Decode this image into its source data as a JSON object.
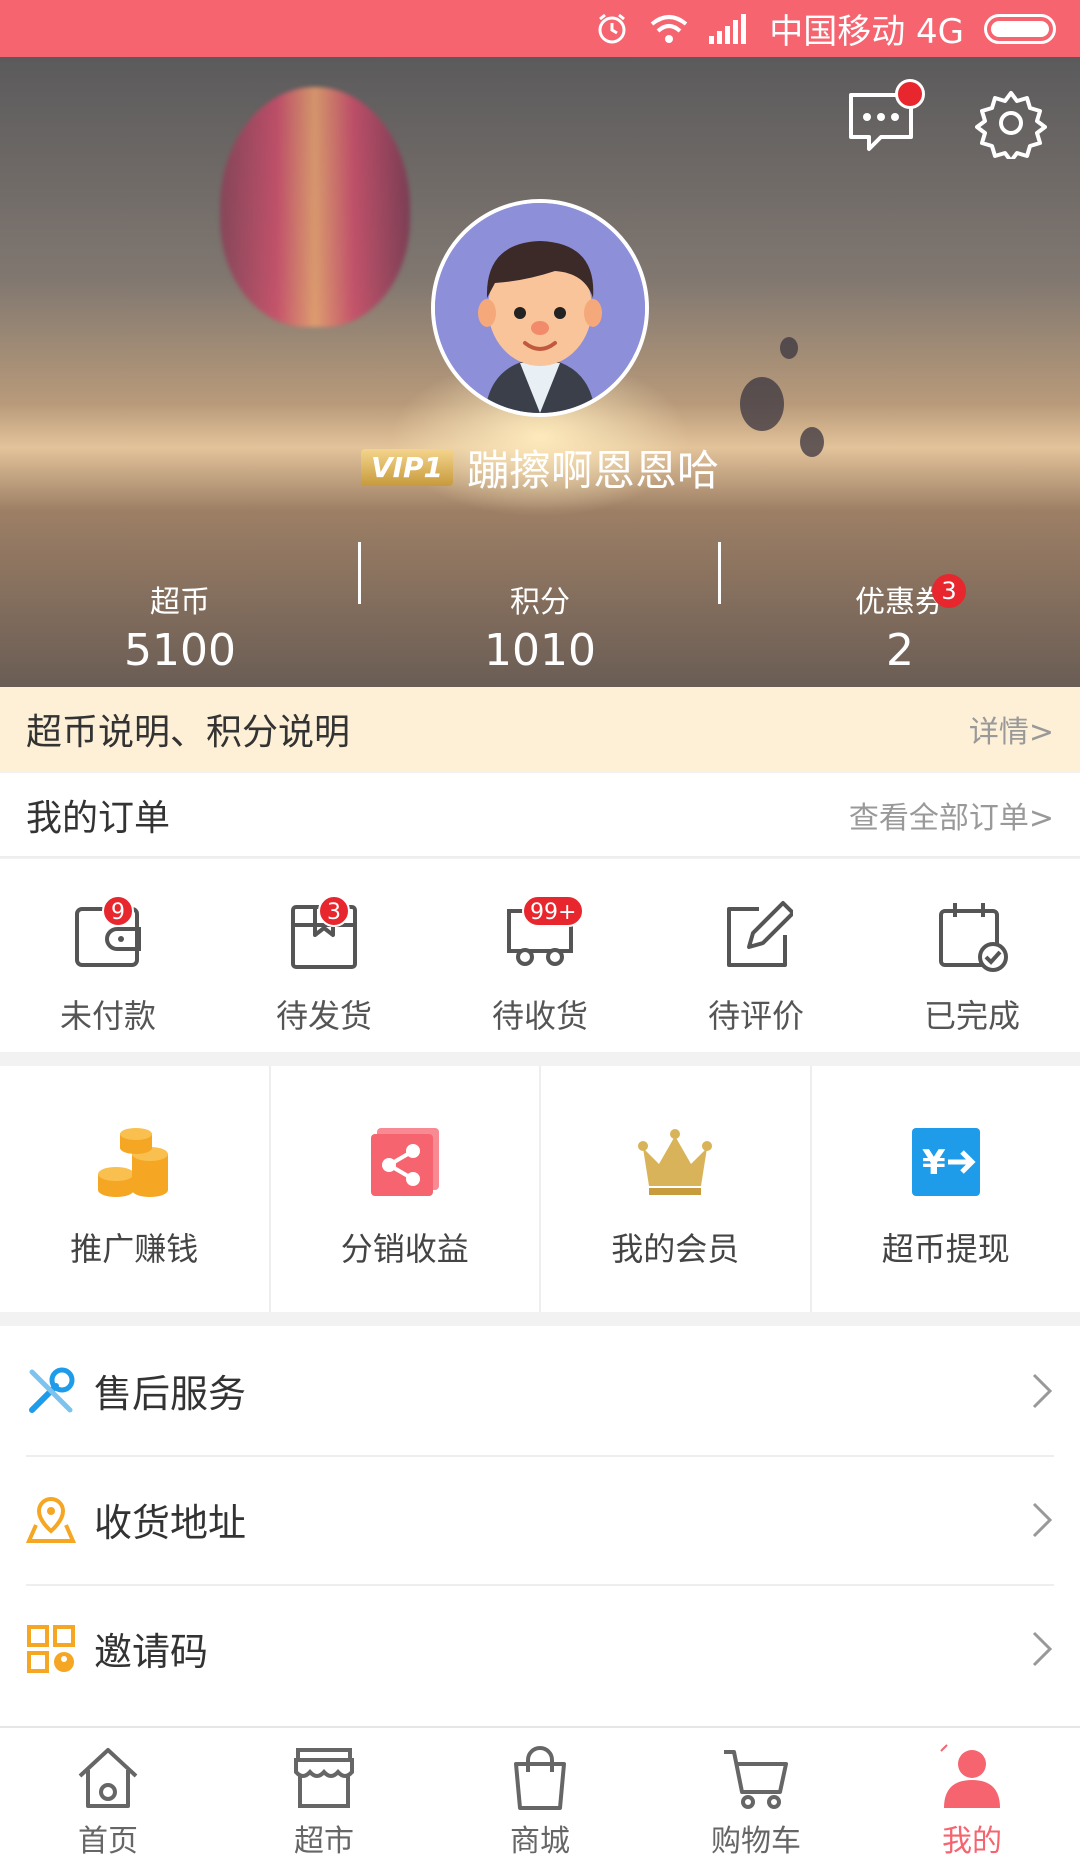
{
  "status_bar": {
    "carrier": "中国移动 4G"
  },
  "header": {
    "vip_label": "VIP1",
    "username": "蹦擦啊恩恩哈",
    "stats": [
      {
        "label": "超币",
        "value": "5100"
      },
      {
        "label": "积分",
        "value": "1010"
      },
      {
        "label": "优惠券",
        "value": "2",
        "badge": "3"
      }
    ]
  },
  "info_bar": {
    "text": "超币说明、积分说明",
    "link": "详情>"
  },
  "orders": {
    "title": "我的订单",
    "view_all": "查看全部订单>",
    "items": [
      {
        "label": "未付款",
        "badge": "9",
        "icon": "wallet-icon"
      },
      {
        "label": "待发货",
        "badge": "3",
        "icon": "package-icon"
      },
      {
        "label": "待收货",
        "badge": "99+",
        "icon": "delivery-truck-icon"
      },
      {
        "label": "待评价",
        "badge": "",
        "icon": "edit-review-icon"
      },
      {
        "label": "已完成",
        "badge": "",
        "icon": "calendar-check-icon"
      }
    ]
  },
  "services": [
    {
      "label": "推广赚钱",
      "icon": "coins-icon",
      "color": "#f5a623"
    },
    {
      "label": "分销收益",
      "icon": "share-icon",
      "color": "#f5646f"
    },
    {
      "label": "我的会员",
      "icon": "crown-icon",
      "color": "#d9b35a"
    },
    {
      "label": "超币提现",
      "icon": "exchange-icon",
      "color": "#1e9be9"
    }
  ],
  "list": [
    {
      "label": "售后服务",
      "icon": "tools-icon"
    },
    {
      "label": "收货地址",
      "icon": "location-map-icon"
    },
    {
      "label": "邀请码",
      "icon": "qr-code-icon"
    }
  ],
  "tabbar": {
    "active_color": "#f5646f",
    "items": [
      {
        "label": "首页",
        "icon": "home-icon"
      },
      {
        "label": "超市",
        "icon": "store-icon"
      },
      {
        "label": "商城",
        "icon": "shopping-bag-icon"
      },
      {
        "label": "购物车",
        "icon": "cart-icon"
      },
      {
        "label": "我的",
        "icon": "user-icon"
      }
    ]
  }
}
